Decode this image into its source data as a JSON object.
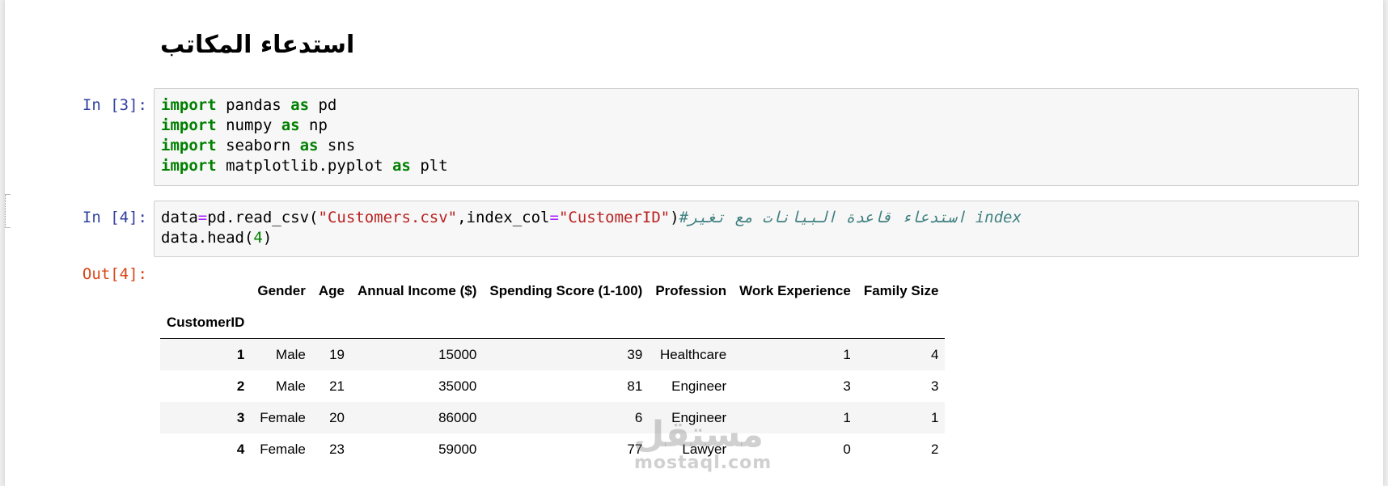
{
  "markdown": {
    "heading": "استدعاء المكاتب"
  },
  "cells": [
    {
      "prompt": "In [3]:",
      "lines": [
        [
          [
            "kw",
            "import"
          ],
          [
            "t",
            " pandas "
          ],
          [
            "kw",
            "as"
          ],
          [
            "t",
            " pd"
          ]
        ],
        [
          [
            "kw",
            "import"
          ],
          [
            "t",
            " numpy "
          ],
          [
            "kw",
            "as"
          ],
          [
            "t",
            " np"
          ]
        ],
        [
          [
            "kw",
            "import"
          ],
          [
            "t",
            " seaborn "
          ],
          [
            "kw",
            "as"
          ],
          [
            "t",
            " sns"
          ]
        ],
        [
          [
            "kw",
            "import"
          ],
          [
            "t",
            " matplotlib.pyplot "
          ],
          [
            "kw",
            "as"
          ],
          [
            "t",
            " plt"
          ]
        ]
      ]
    },
    {
      "prompt": "In [4]:",
      "lines": [
        [
          [
            "t",
            "data"
          ],
          [
            "op",
            "="
          ],
          [
            "t",
            "pd.read_csv("
          ],
          [
            "str",
            "\"Customers.csv\""
          ],
          [
            "t",
            ",index_col"
          ],
          [
            "op",
            "="
          ],
          [
            "str",
            "\"CustomerID\""
          ],
          [
            "t",
            ")"
          ],
          [
            "cmt",
            "#استدعاء قاعدة البيانات مع تغير index"
          ]
        ],
        [
          [
            "t",
            "data.head("
          ],
          [
            "num",
            "4"
          ],
          [
            "t",
            ")"
          ]
        ]
      ]
    }
  ],
  "output": {
    "prompt": "Out[4]:",
    "index_name": "CustomerID",
    "columns": [
      "Gender",
      "Age",
      "Annual Income ($)",
      "Spending Score (1-100)",
      "Profession",
      "Work Experience",
      "Family Size"
    ],
    "rows": [
      {
        "index": "1",
        "values": [
          "Male",
          "19",
          "15000",
          "39",
          "Healthcare",
          "1",
          "4"
        ]
      },
      {
        "index": "2",
        "values": [
          "Male",
          "21",
          "35000",
          "81",
          "Engineer",
          "3",
          "3"
        ]
      },
      {
        "index": "3",
        "values": [
          "Female",
          "20",
          "86000",
          "6",
          "Engineer",
          "1",
          "1"
        ]
      },
      {
        "index": "4",
        "values": [
          "Female",
          "23",
          "59000",
          "77",
          "Lawyer",
          "0",
          "2"
        ]
      }
    ]
  },
  "watermark": {
    "arabic": "مستقل",
    "latin": "mostaql.com"
  },
  "colors": {
    "prompt_in": "#303F9F",
    "prompt_out": "#D84315",
    "keyword": "#008000",
    "string": "#BA2121",
    "operator": "#AA22FF",
    "comment": "#408080"
  }
}
